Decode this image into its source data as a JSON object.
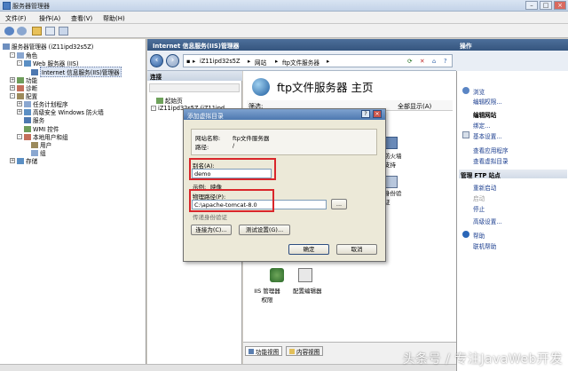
{
  "window": {
    "title": "服务器管理器"
  },
  "menu": [
    "文件(F)",
    "操作(A)",
    "查看(V)",
    "帮助(H)"
  ],
  "tree": {
    "root": "服务器管理器 (iZ11ipd32s5Z)",
    "items": [
      {
        "label": "角色",
        "depth": 1,
        "exp": "-"
      },
      {
        "label": "Web 服务器 (IIS)",
        "depth": 2,
        "exp": "-"
      },
      {
        "label": "Internet 信息服务(IIS)管理器",
        "depth": 3,
        "exp": "",
        "selected": true
      },
      {
        "label": "功能",
        "depth": 1,
        "exp": "+"
      },
      {
        "label": "诊断",
        "depth": 1,
        "exp": "+"
      },
      {
        "label": "配置",
        "depth": 1,
        "exp": "-"
      },
      {
        "label": "任务计划程序",
        "depth": 2,
        "exp": "+"
      },
      {
        "label": "高级安全 Windows 防火墙",
        "depth": 2,
        "exp": "+"
      },
      {
        "label": "服务",
        "depth": 2,
        "exp": ""
      },
      {
        "label": "WMI 控件",
        "depth": 2,
        "exp": ""
      },
      {
        "label": "本地用户和组",
        "depth": 2,
        "exp": "-"
      },
      {
        "label": "用户",
        "depth": 3,
        "exp": ""
      },
      {
        "label": "组",
        "depth": 3,
        "exp": ""
      },
      {
        "label": "存储",
        "depth": 1,
        "exp": "+"
      }
    ]
  },
  "center": {
    "header": "Internet 信息服务(IIS)管理器",
    "crumbs": [
      "iZ11ipd32s5Z",
      "网站",
      "ftp文件服务器"
    ],
    "connections_header": "连接",
    "conn_items": [
      "起始页",
      "iZ11ipd32s5Z (iZ11ipd..."
    ],
    "title": "ftp文件服务器 主页",
    "filter_label": "筛选:",
    "show_all": "全部显示(A)",
    "features": [
      {
        "label": "防火墙支持"
      },
      {
        "label": "身份验证"
      },
      {
        "label": "IIS 管理器权限"
      },
      {
        "label": "配置编辑器"
      }
    ],
    "tabs": [
      "功能视图",
      "内容视图"
    ]
  },
  "actions": {
    "header": "操作",
    "items": [
      {
        "label": "浏览",
        "disabled": false
      },
      {
        "label": "编辑权限...",
        "disabled": false
      }
    ],
    "group1_header": "编辑网站",
    "group1": [
      {
        "label": "绑定...",
        "disabled": false
      },
      {
        "label": "基本设置...",
        "disabled": false
      },
      {
        "label": "查看应用程序",
        "disabled": false
      },
      {
        "label": "查看虚拟目录",
        "disabled": false
      }
    ],
    "group2_header": "管理 FTP 站点",
    "group2": [
      {
        "label": "重新启动",
        "disabled": false
      },
      {
        "label": "启动",
        "disabled": true
      },
      {
        "label": "停止",
        "disabled": false
      },
      {
        "label": "高级设置...",
        "disabled": false
      }
    ],
    "help": "帮助",
    "online_help": "联机帮助"
  },
  "dialog": {
    "title": "添加虚拟目录",
    "site_name_label": "网站名称:",
    "site_name_value": "ftp文件服务器",
    "path_label": "路径:",
    "path_value": "/",
    "alias_label": "别名(A):",
    "alias_value": "demo",
    "example_label": "示例:",
    "example_value": "映像",
    "physical_path_label": "物理路径(P):",
    "physical_path_value": "C:\\apache-tomcat-8.0",
    "browse_label": "...",
    "pass_through": "传递身份验证",
    "connect_as": "连接为(C)...",
    "test_settings": "测试设置(G)...",
    "ok": "确定",
    "cancel": "取消",
    "help_btn": "?",
    "close_btn": "×"
  },
  "watermark": "头条号 / 专注JavaWeb开发",
  "colors": {
    "highlight_box": "#d9262b",
    "header_blue": "#35557f"
  }
}
